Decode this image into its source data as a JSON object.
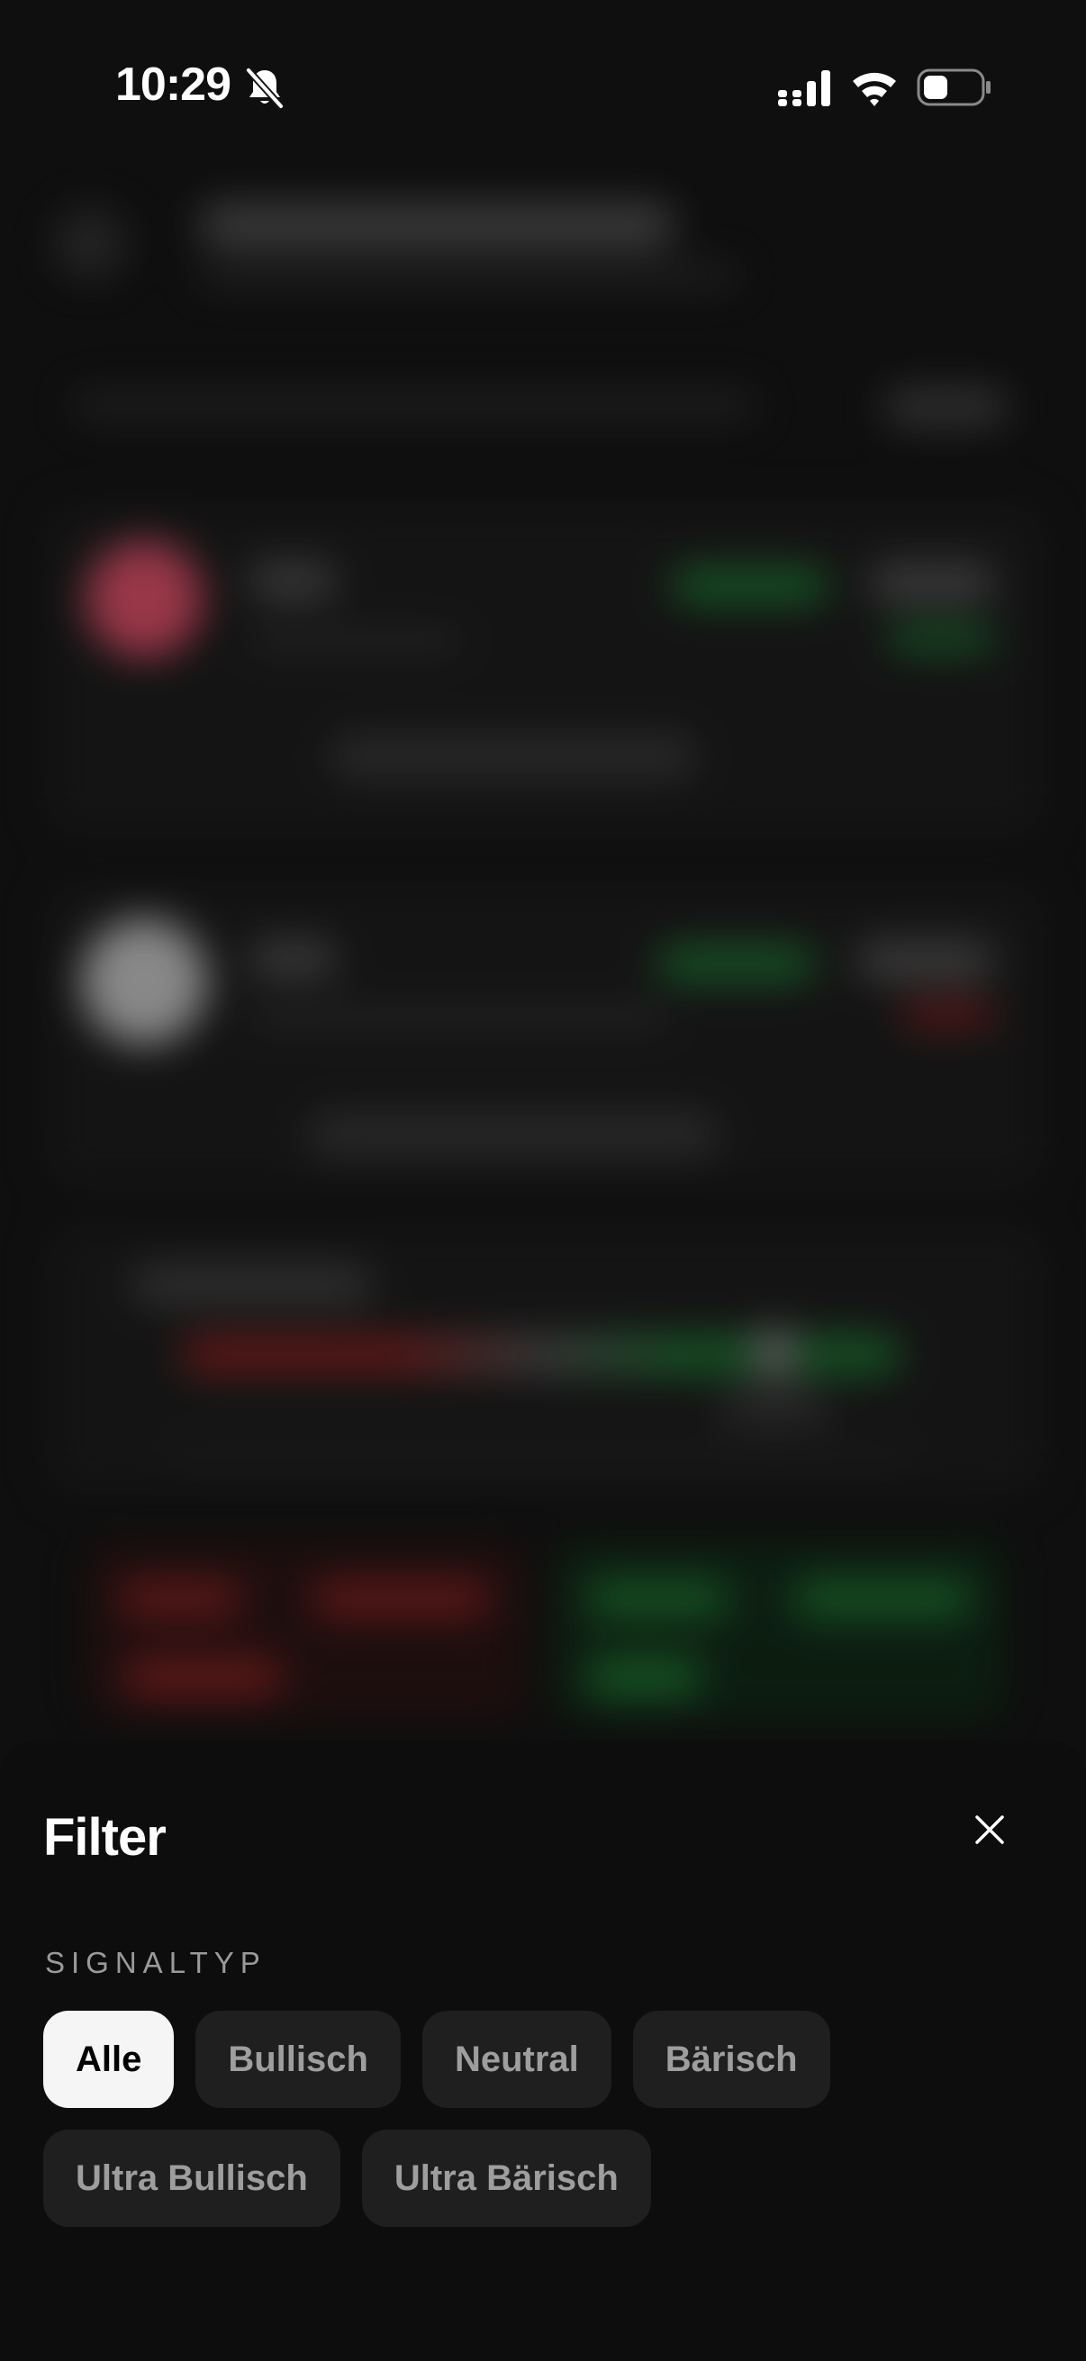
{
  "status_bar": {
    "time": "10:29"
  },
  "sheet": {
    "title": "Filter",
    "section_label": "SIGNALTYP",
    "selected": "Alle",
    "chips": [
      {
        "label": "Alle",
        "active": true
      },
      {
        "label": "Bullisch",
        "active": false
      },
      {
        "label": "Neutral",
        "active": false
      },
      {
        "label": "Bärisch",
        "active": false
      },
      {
        "label": "Ultra Bullisch",
        "active": false
      },
      {
        "label": "Ultra Bärisch",
        "active": false
      }
    ]
  },
  "icons": {
    "status": [
      "bell-slash-icon",
      "cellular-signal-icon",
      "wifi-icon",
      "battery-icon"
    ],
    "sheet": [
      "close-icon"
    ]
  },
  "colors": {
    "background": "#141414",
    "sheet_background": "#0d0d0d",
    "chip_background": "#1f1f1f",
    "chip_active_background": "#f5f5f5",
    "chip_text": "#9e9e9e",
    "bullish_green": "#1f7a34",
    "bearish_red": "#8a2222"
  }
}
